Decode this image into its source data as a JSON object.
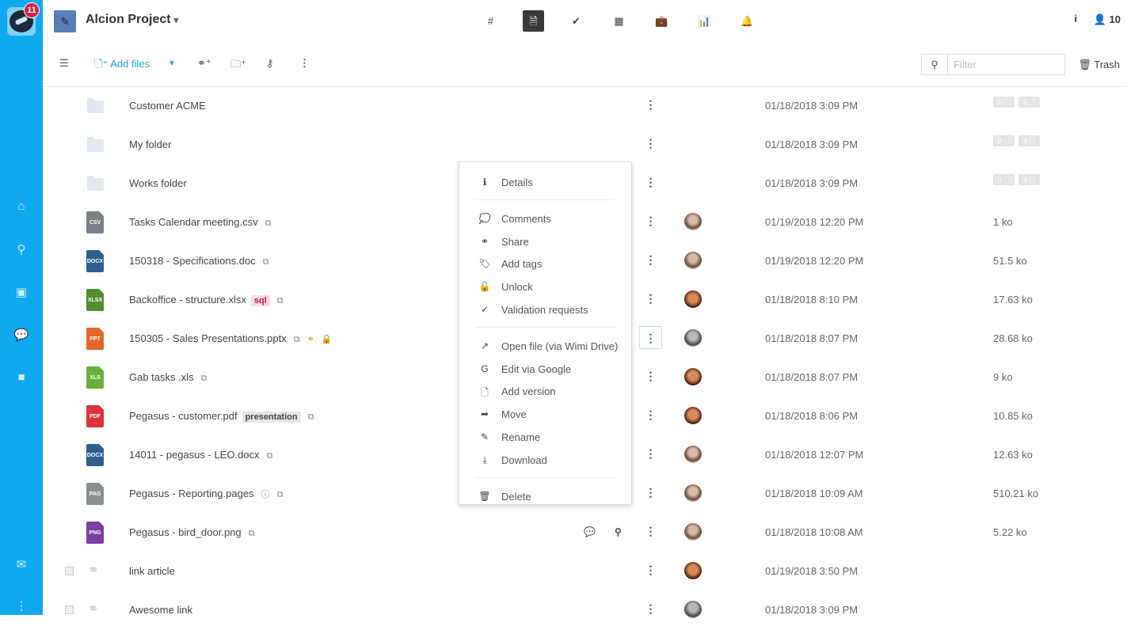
{
  "app": {
    "notification_count": "11",
    "project_title": "Alcion Project",
    "info_label": "i",
    "members_count": "10"
  },
  "sidebar": {
    "items": [
      {
        "name": "home",
        "glyph": "⌂"
      },
      {
        "name": "search",
        "glyph": "⚲"
      },
      {
        "name": "contacts",
        "glyph": "▣"
      },
      {
        "name": "chat",
        "glyph": "💬"
      },
      {
        "name": "video",
        "glyph": "■"
      },
      {
        "name": "mail",
        "glyph": "✉"
      },
      {
        "name": "more",
        "glyph": "⋮"
      }
    ]
  },
  "topnav": [
    {
      "name": "hashtag",
      "glyph": "#"
    },
    {
      "name": "files",
      "glyph": "🗎",
      "active": true
    },
    {
      "name": "tasks",
      "glyph": "✔"
    },
    {
      "name": "calendar",
      "glyph": "▦"
    },
    {
      "name": "briefcase",
      "glyph": "💼"
    },
    {
      "name": "stats",
      "glyph": "📊"
    },
    {
      "name": "notifications",
      "glyph": "🔔"
    }
  ],
  "toolbar": {
    "add_files_label": "Add files",
    "filter_placeholder": "Filter",
    "filter_value": "",
    "trash_label": "Trash"
  },
  "files": [
    {
      "type": "folder",
      "name": "Customer ACME",
      "date": "01/18/2018 3:09 PM",
      "folders": "5",
      "files": "6"
    },
    {
      "type": "folder",
      "name": "My folder",
      "date": "01/18/2018 3:09 PM",
      "folders": "0",
      "files": "3"
    },
    {
      "type": "folder",
      "name": "Works folder",
      "date": "01/18/2018 3:09 PM",
      "folders": "0",
      "files": "3"
    },
    {
      "type": "file",
      "ext": "CSV",
      "color": "#7a8285",
      "name": "Tasks Calendar meeting.csv",
      "date": "01/19/2018 12:20 PM",
      "size": "1 ko",
      "avatar": "woman"
    },
    {
      "type": "file",
      "ext": "DOCX",
      "color": "#2f5f8f",
      "name": "150318 - Specifications.doc",
      "date": "01/19/2018 12:20 PM",
      "size": "51.5 ko",
      "avatar": "woman"
    },
    {
      "type": "file",
      "ext": "XLSX",
      "color": "#4f8f2f",
      "name": "Backoffice - structure.xlsx",
      "tag": "sql",
      "tag_style": "pink",
      "date": "01/18/2018 8:10 PM",
      "size": "17.63 ko",
      "avatar": "man"
    },
    {
      "type": "file",
      "ext": "PPT",
      "color": "#e2682a",
      "name": "150305 - Sales Presentations.pptx",
      "shared": true,
      "locked": true,
      "date": "01/18/2018 8:07 PM",
      "size": "28.68 ko",
      "avatar": "man2"
    },
    {
      "type": "file",
      "ext": "XLS",
      "color": "#6aaf3a",
      "name": "Gab tasks .xls",
      "date": "01/18/2018 8:07 PM",
      "size": "9 ko",
      "avatar": "man"
    },
    {
      "type": "file",
      "ext": "PDF",
      "color": "#d9343f",
      "name": "Pegasus - customer.pdf",
      "tag": "presentation",
      "tag_style": "gray",
      "date": "01/18/2018 8:06 PM",
      "size": "10.85 ko",
      "avatar": "man"
    },
    {
      "type": "file",
      "ext": "DOCX",
      "color": "#2f5f8f",
      "name": "14011 - pegasus - LEO.docx",
      "date": "01/18/2018 12:07 PM",
      "size": "12.63 ko",
      "avatar": "woman"
    },
    {
      "type": "file",
      "ext": "PAG",
      "color": "#8a8f90",
      "name": "Pegasus - Reporting.pages",
      "info": true,
      "date": "01/18/2018 10:09 AM",
      "size": "510.21 ko",
      "avatar": "woman"
    },
    {
      "type": "file",
      "ext": "PNG",
      "color": "#7a3fa0",
      "name": "Pegasus - bird_door.png",
      "hover_actions": true,
      "date": "01/18/2018 10:08 AM",
      "size": "5.22 ko",
      "avatar": "woman"
    },
    {
      "type": "link",
      "name": "link article",
      "date": "01/19/2018 3:50 PM",
      "avatar": "man"
    },
    {
      "type": "link",
      "name": "Awesome link",
      "date": "01/18/2018 3:09 PM",
      "avatar": "man2"
    }
  ],
  "context_menu": {
    "groups": [
      [
        {
          "name": "details",
          "label": "Details",
          "glyph": "ℹ"
        }
      ],
      [
        {
          "name": "comments",
          "label": "Comments",
          "glyph": "💭"
        },
        {
          "name": "share",
          "label": "Share",
          "glyph": "⚭"
        },
        {
          "name": "add-tags",
          "label": "Add tags",
          "glyph": "🏷"
        },
        {
          "name": "unlock",
          "label": "Unlock",
          "glyph": "🔓"
        },
        {
          "name": "validation-requests",
          "label": "Validation requests",
          "glyph": "✓"
        }
      ],
      [
        {
          "name": "open-file",
          "label": "Open file (via Wimi Drive)",
          "glyph": "↗"
        },
        {
          "name": "edit-google",
          "label": "Edit via Google",
          "glyph": "G"
        },
        {
          "name": "add-version",
          "label": "Add version",
          "glyph": "🗋"
        },
        {
          "name": "move",
          "label": "Move",
          "glyph": "➦"
        },
        {
          "name": "rename",
          "label": "Rename",
          "glyph": "✎"
        },
        {
          "name": "download",
          "label": "Download",
          "glyph": "⤓"
        }
      ],
      [
        {
          "name": "delete",
          "label": "Delete",
          "glyph": "🗑"
        }
      ]
    ]
  }
}
